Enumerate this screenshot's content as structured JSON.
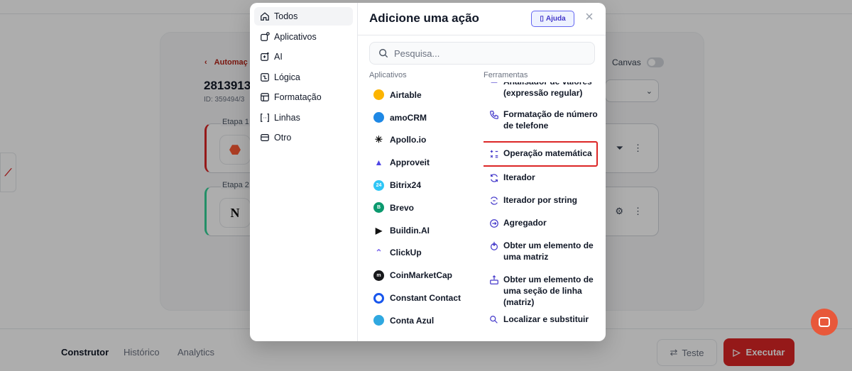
{
  "background": {
    "back_link": "Automaç",
    "automation_id": "2813913",
    "automation_sub": "ID: 359494/3",
    "canvas_label": "Canvas",
    "steps": [
      {
        "label": "Etapa 1"
      },
      {
        "label": "Etapa 2"
      }
    ],
    "bottom_tabs": [
      "Construtor",
      "Histórico",
      "Analytics"
    ],
    "test_button": "Teste",
    "run_button": "Executar"
  },
  "modal": {
    "title": "Adicione uma ação",
    "help_label": "Ajuda",
    "search": {
      "placeholder": "Pesquisa...",
      "value": ""
    },
    "categories": [
      {
        "label": "Todos",
        "icon": "home-icon",
        "active": true
      },
      {
        "label": "Aplicativos",
        "icon": "apps-icon"
      },
      {
        "label": "AI",
        "icon": "ai-sparkle-icon"
      },
      {
        "label": "Lógica",
        "icon": "logic-icon"
      },
      {
        "label": "Formatação",
        "icon": "format-icon"
      },
      {
        "label": "Linhas",
        "icon": "lines-icon"
      },
      {
        "label": "Otro",
        "icon": "other-icon"
      }
    ],
    "apps_header": "Aplicativos",
    "apps": [
      {
        "name": "Airtable",
        "color": "#fcb400"
      },
      {
        "name": "amoCRM",
        "color": "#1e88e5"
      },
      {
        "name": "Apollo.io",
        "color": "#111827"
      },
      {
        "name": "Approveit",
        "color": "#4f46e5"
      },
      {
        "name": "Bitrix24",
        "color": "#2fc6f6"
      },
      {
        "name": "Brevo",
        "color": "#0b996e"
      },
      {
        "name": "Buildin.AI",
        "color": "#111827"
      },
      {
        "name": "ClickUp",
        "color": "#7b68ee"
      },
      {
        "name": "CoinMarketCap",
        "color": "#17181b"
      },
      {
        "name": "Constant Contact",
        "color": "#1856ed"
      },
      {
        "name": "Conta Azul",
        "color": "#2fa8e0"
      }
    ],
    "tools_header": "Ferramentas",
    "tools": [
      {
        "label": "Analisador de valores (expressão regular)",
        "icon": "regex-icon"
      },
      {
        "label": "Formatação de número de telefone",
        "icon": "phone-icon"
      },
      {
        "label": "Operação matemática",
        "icon": "math-icon",
        "highlighted": true
      },
      {
        "label": "Iterador",
        "icon": "iterator-icon"
      },
      {
        "label": "Iterador por string",
        "icon": "iterator-string-icon"
      },
      {
        "label": "Agregador",
        "icon": "aggregator-icon"
      },
      {
        "label": "Obter um elemento de uma matriz",
        "icon": "array-element-icon"
      },
      {
        "label": "Obter um elemento de uma seção de linha (matriz)",
        "icon": "row-section-icon"
      },
      {
        "label": "Localizar e substituir",
        "icon": "find-replace-icon"
      }
    ]
  },
  "colors": {
    "accent": "#dc2626",
    "help": "#4338ca",
    "highlight": "#dc2626"
  }
}
